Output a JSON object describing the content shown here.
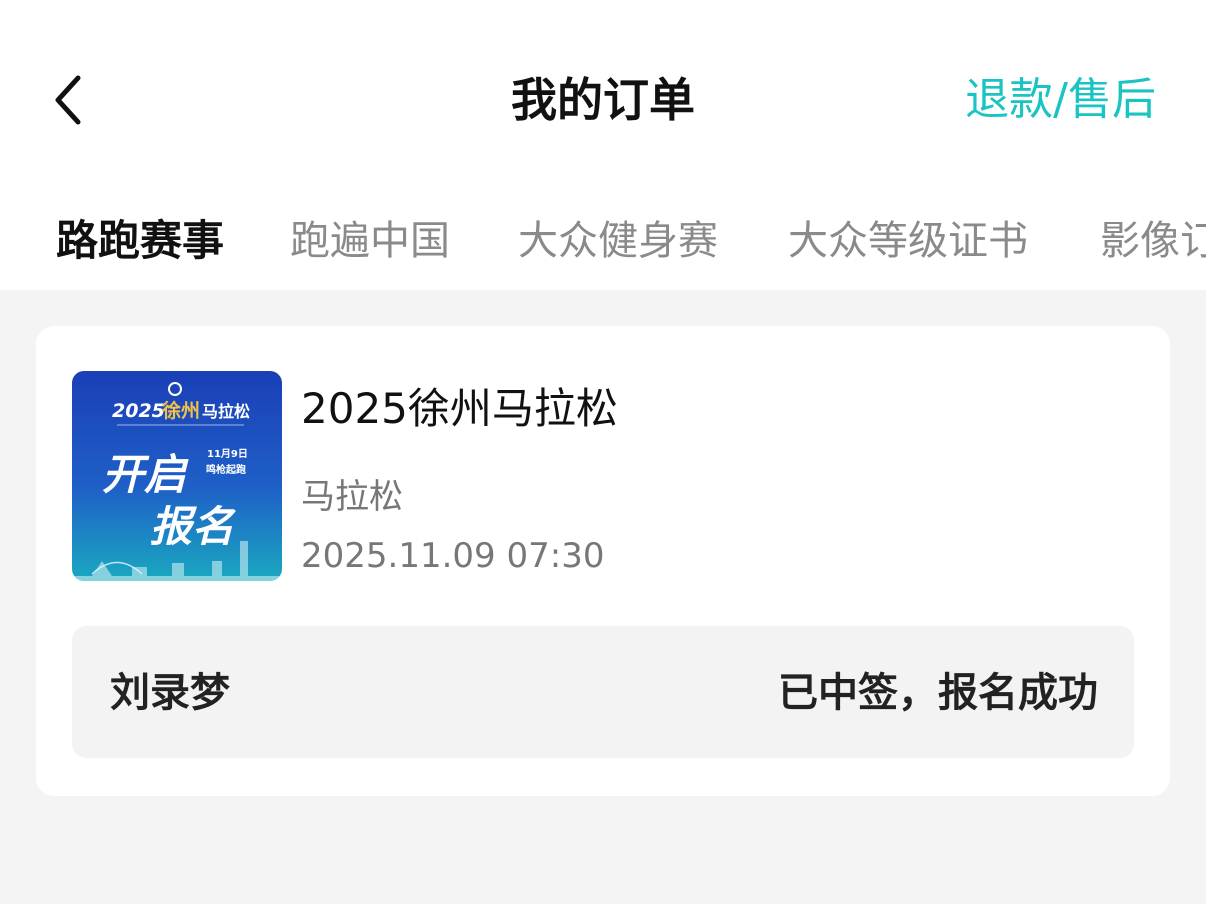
{
  "header": {
    "title": "我的订单",
    "refund_link": "退款/售后"
  },
  "tabs": [
    {
      "label": "路跑赛事",
      "active": true
    },
    {
      "label": "跑遍中国",
      "active": false
    },
    {
      "label": "大众健身赛",
      "active": false
    },
    {
      "label": "大众等级证书",
      "active": false
    },
    {
      "label": "影像订",
      "active": false
    }
  ],
  "order": {
    "event_name": "2025徐州马拉松",
    "event_type": "马拉松",
    "event_time": "2025.11.09 07:30",
    "participant_name": "刘录梦",
    "status": "已中签，报名成功",
    "poster": {
      "headline_top": "2025",
      "headline_city": "徐州",
      "headline_rest": "马拉松",
      "big_line1": "开启",
      "big_line2": "报名",
      "date_badge_1": "11月9日",
      "date_badge_2": "鸣枪起跑"
    }
  },
  "colors": {
    "accent": "#19c4c2",
    "page_bg": "#f4f4f4",
    "card_bg": "#ffffff",
    "participant_bg": "#f3f3f3",
    "tab_inactive": "#8a8a8a"
  },
  "icons": {
    "back": "chevron-left-icon"
  }
}
